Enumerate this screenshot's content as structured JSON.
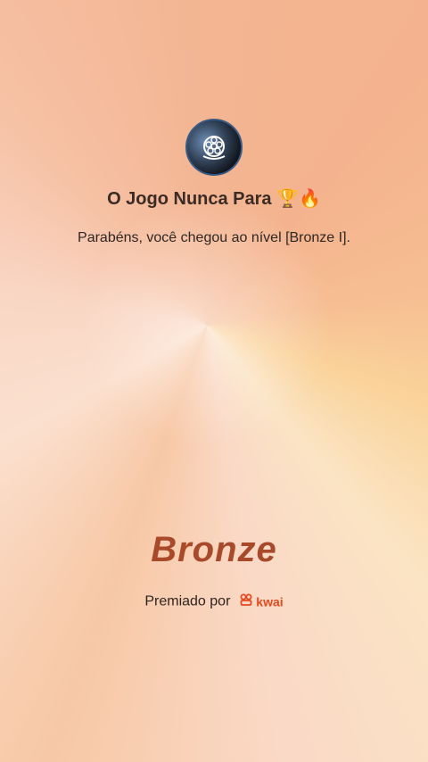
{
  "profile": {
    "title": "O Jogo Nunca Para 🏆🔥",
    "avatar_icon": "turtle-shell-icon"
  },
  "message": {
    "text": "Parabéns, você chegou ao nível [Bronze I]."
  },
  "badge": {
    "level": "Bronze",
    "color": "#a84a2a"
  },
  "footer": {
    "awarded_by": "Premiado por",
    "brand": "kwai",
    "brand_color": "#e24a1f",
    "brand_icon": "kwai-logo-icon"
  }
}
